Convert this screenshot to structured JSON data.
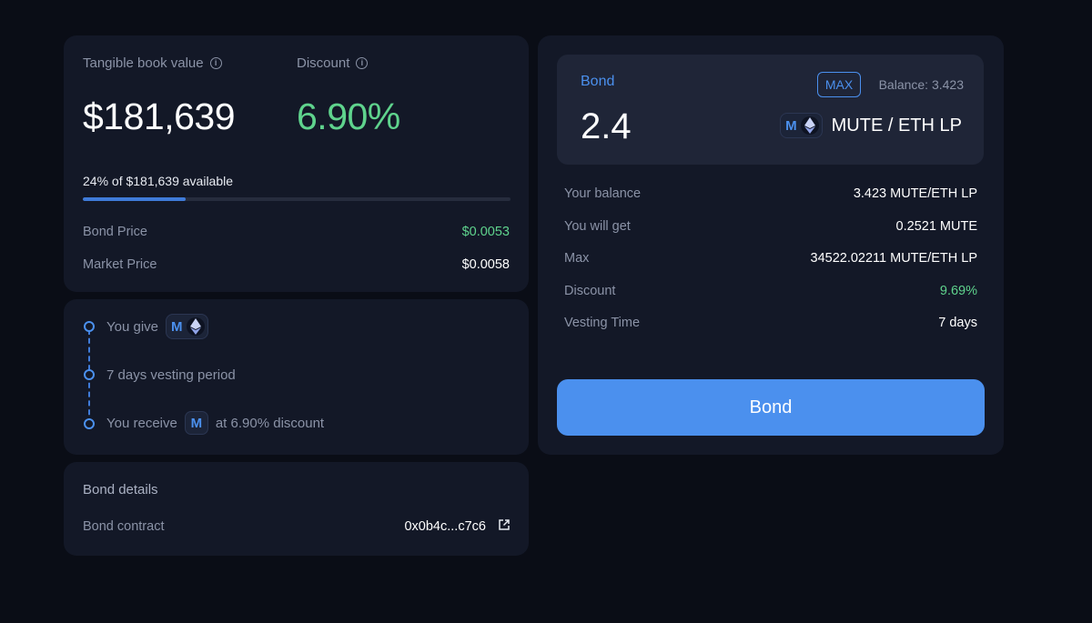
{
  "stats": {
    "tbv_label": "Tangible book value",
    "tbv_value": "$181,639",
    "discount_label": "Discount",
    "discount_value": "6.90%",
    "available_text": "24% of $181,639 available",
    "available_fraction": 0.24,
    "bond_price_label": "Bond Price",
    "bond_price_value": "$0.0053",
    "market_price_label": "Market Price",
    "market_price_value": "$0.0058"
  },
  "flow": {
    "give_label": "You give",
    "vesting_label": "7 days vesting period",
    "receive_label": "You receive",
    "receive_suffix": "at 6.90% discount",
    "token_letter": "M"
  },
  "details": {
    "title": "Bond details",
    "contract_label": "Bond contract",
    "contract_value": "0x0b4c...c7c6"
  },
  "bond_form": {
    "label": "Bond",
    "max_label": "MAX",
    "balance_text": "Balance: 3.423",
    "amount": "2.4",
    "token_letter": "M",
    "pair_label": "MUTE / ETH LP",
    "rows": [
      {
        "label": "Your balance",
        "value": "3.423 MUTE/ETH LP"
      },
      {
        "label": "You will get",
        "value": "0.2521 MUTE"
      },
      {
        "label": "Max",
        "value": "34522.02211 MUTE/ETH LP"
      },
      {
        "label": "Discount",
        "value": "9.69%"
      },
      {
        "label": "Vesting Time",
        "value": "7 days"
      }
    ],
    "submit_label": "Bond"
  },
  "colors": {
    "accent": "#4b90ee",
    "positive": "#5fd38d",
    "background": "#0a0d16",
    "card": "#131827"
  },
  "icons": [
    "info-icon",
    "mute-token-icon",
    "eth-token-icon",
    "external-link-icon"
  ]
}
